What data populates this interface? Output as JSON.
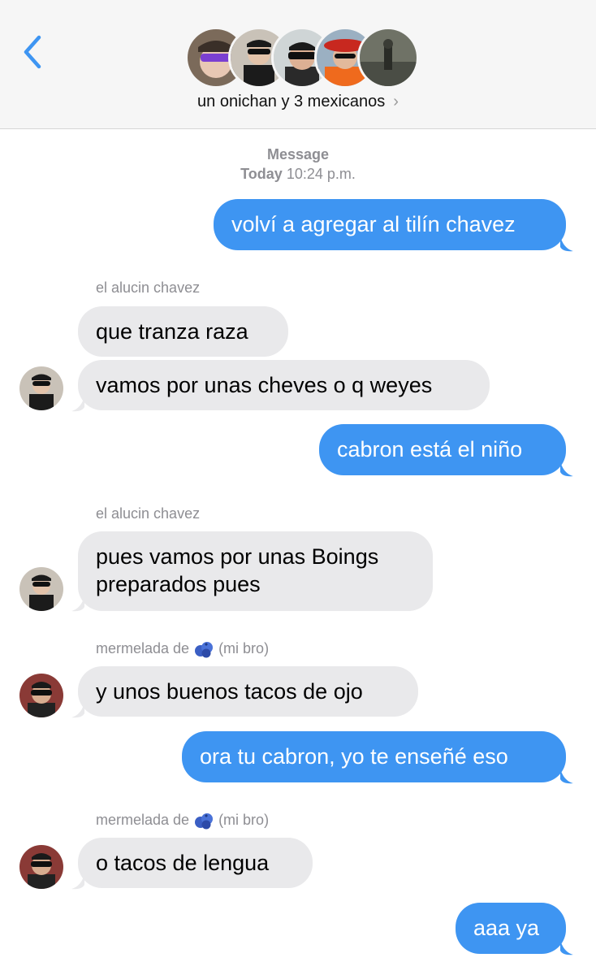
{
  "header": {
    "back_icon": "chevron-left-icon",
    "group_name": "un onichan y 3 mexicanos",
    "disclosure": "›",
    "accent": "#3e95f2"
  },
  "thread": {
    "service_label": "Message",
    "day": "Today",
    "time": "10:24 p.m."
  },
  "messages": [
    {
      "dir": "out",
      "text": "volví a agregar al tilín chavez"
    },
    {
      "dir": "in",
      "sender": "el alucin chavez",
      "lines": [
        "que tranza raza"
      ]
    },
    {
      "dir": "in",
      "lines": [
        "vamos por unas cheves o q weyes"
      ]
    },
    {
      "dir": "out",
      "text": "cabron está el niño"
    },
    {
      "dir": "in",
      "sender": "el alucin chavez",
      "lines": [
        "pues vamos por unas Boings",
        "preparados pues"
      ]
    },
    {
      "dir": "in",
      "sender_prefix": "mermelada de",
      "sender_emoji": "blueberries-icon",
      "sender_suffix": "(mi bro)",
      "lines": [
        "y unos buenos tacos de ojo"
      ]
    },
    {
      "dir": "out",
      "text": "ora tu cabron, yo te enseñé eso"
    },
    {
      "dir": "in",
      "sender_prefix": "mermelada de",
      "sender_emoji": "blueberries-icon",
      "sender_suffix": "(mi bro)",
      "lines": [
        "o tacos de lengua"
      ]
    },
    {
      "dir": "out",
      "text": "aaa ya"
    }
  ],
  "colors": {
    "outgoing_bubble": "#3e95f2",
    "incoming_bubble": "#e9e9eb",
    "header_bg": "#f6f6f6",
    "meta_text": "#8e8e93"
  }
}
